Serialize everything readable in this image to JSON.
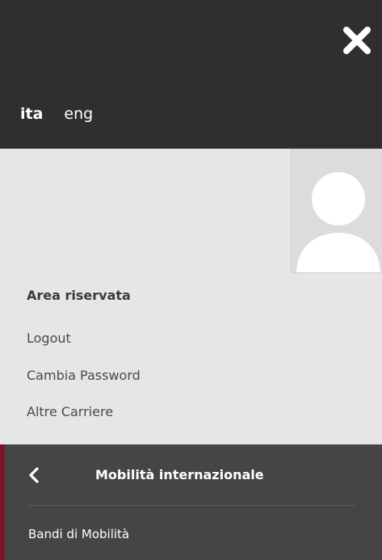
{
  "language": {
    "active": "ita",
    "other": "eng"
  },
  "reserved_area": {
    "title": "Area riservata",
    "links": [
      "Logout",
      "Cambia Password",
      "Altre Carriere"
    ]
  },
  "menu": {
    "section_title": "Mobilità internazionale",
    "items": [
      "Bandi di Mobilità"
    ]
  }
}
